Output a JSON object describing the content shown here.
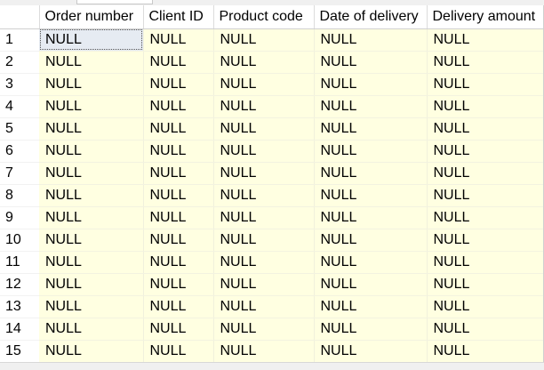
{
  "grid": {
    "columns": [
      "Order number",
      "Client ID",
      "Product code",
      "Date of delivery",
      "Delivery amount"
    ],
    "rows": [
      {
        "num": "1",
        "cells": [
          "NULL",
          "NULL",
          "NULL",
          "NULL",
          "NULL"
        ]
      },
      {
        "num": "2",
        "cells": [
          "NULL",
          "NULL",
          "NULL",
          "NULL",
          "NULL"
        ]
      },
      {
        "num": "3",
        "cells": [
          "NULL",
          "NULL",
          "NULL",
          "NULL",
          "NULL"
        ]
      },
      {
        "num": "4",
        "cells": [
          "NULL",
          "NULL",
          "NULL",
          "NULL",
          "NULL"
        ]
      },
      {
        "num": "5",
        "cells": [
          "NULL",
          "NULL",
          "NULL",
          "NULL",
          "NULL"
        ]
      },
      {
        "num": "6",
        "cells": [
          "NULL",
          "NULL",
          "NULL",
          "NULL",
          "NULL"
        ]
      },
      {
        "num": "7",
        "cells": [
          "NULL",
          "NULL",
          "NULL",
          "NULL",
          "NULL"
        ]
      },
      {
        "num": "8",
        "cells": [
          "NULL",
          "NULL",
          "NULL",
          "NULL",
          "NULL"
        ]
      },
      {
        "num": "9",
        "cells": [
          "NULL",
          "NULL",
          "NULL",
          "NULL",
          "NULL"
        ]
      },
      {
        "num": "10",
        "cells": [
          "NULL",
          "NULL",
          "NULL",
          "NULL",
          "NULL"
        ]
      },
      {
        "num": "11",
        "cells": [
          "NULL",
          "NULL",
          "NULL",
          "NULL",
          "NULL"
        ]
      },
      {
        "num": "12",
        "cells": [
          "NULL",
          "NULL",
          "NULL",
          "NULL",
          "NULL"
        ]
      },
      {
        "num": "13",
        "cells": [
          "NULL",
          "NULL",
          "NULL",
          "NULL",
          "NULL"
        ]
      },
      {
        "num": "14",
        "cells": [
          "NULL",
          "NULL",
          "NULL",
          "NULL",
          "NULL"
        ]
      },
      {
        "num": "15",
        "cells": [
          "NULL",
          "NULL",
          "NULL",
          "NULL",
          "NULL"
        ]
      }
    ],
    "selected_cell": {
      "row": 0,
      "col": 0
    },
    "colors": {
      "cell_background": "#ffffe1",
      "selected_cell_background": "#e6ebf2",
      "header_background": "#ffffff"
    }
  }
}
